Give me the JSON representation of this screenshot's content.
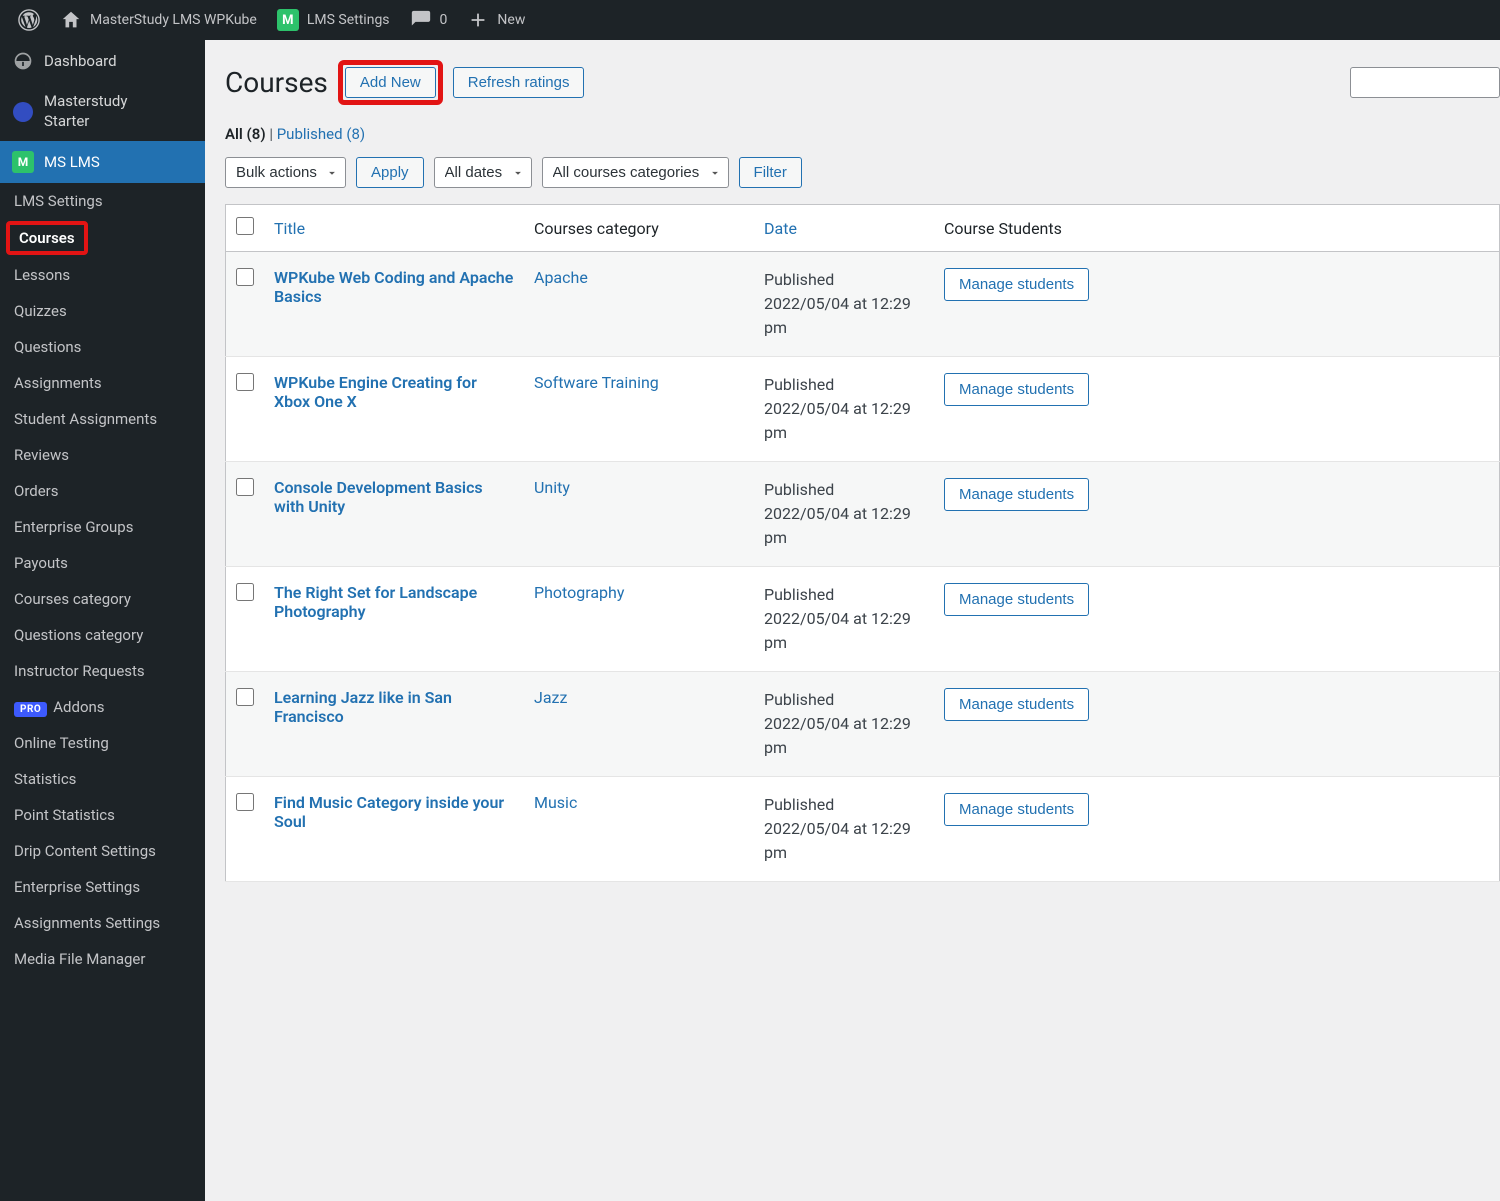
{
  "admin_bar": {
    "site_name": "MasterStudy LMS WPKube",
    "lms_settings": "LMS Settings",
    "comments_count": "0",
    "new": "New"
  },
  "sidebar": {
    "top": [
      {
        "name": "dashboard",
        "label": "Dashboard"
      },
      {
        "name": "masterstudy-starter",
        "label": "Masterstudy\nStarter"
      },
      {
        "name": "ms-lms",
        "label": "MS LMS"
      }
    ],
    "submenu": [
      "LMS Settings",
      "Courses",
      "Lessons",
      "Quizzes",
      "Questions",
      "Assignments",
      "Student Assignments",
      "Reviews",
      "Orders",
      "Enterprise Groups",
      "Payouts",
      "Courses category",
      "Questions category",
      "Instructor Requests",
      "Addons",
      "Online Testing",
      "Statistics",
      "Point Statistics",
      "Drip Content Settings",
      "Enterprise Settings",
      "Assignments Settings",
      "Media File Manager"
    ],
    "pro_label": "PRO"
  },
  "page": {
    "title": "Courses",
    "add_new": "Add New",
    "refresh_ratings": "Refresh ratings"
  },
  "status_filter": {
    "all_label": "All",
    "all_count": "(8)",
    "sep": " | ",
    "published_label": "Published",
    "published_count": "(8)"
  },
  "filters": {
    "bulk": "Bulk actions",
    "apply": "Apply",
    "dates": "All dates",
    "categories": "All courses categories",
    "filter": "Filter"
  },
  "table": {
    "headers": {
      "title": "Title",
      "category": "Courses category",
      "date": "Date",
      "students": "Course Students"
    },
    "manage_label": "Manage students",
    "rows": [
      {
        "title": "WPKube Web Coding and Apache Basics",
        "category": "Apache",
        "status": "Published",
        "date": "2022/05/04 at 12:29 pm"
      },
      {
        "title": "WPKube Engine Creating for Xbox One X",
        "category": "Software Training",
        "status": "Published",
        "date": "2022/05/04 at 12:29 pm"
      },
      {
        "title": "Console Development Basics with Unity",
        "category": "Unity",
        "status": "Published",
        "date": "2022/05/04 at 12:29 pm"
      },
      {
        "title": "The Right Set for Landscape Photography",
        "category": "Photography",
        "status": "Published",
        "date": "2022/05/04 at 12:29 pm"
      },
      {
        "title": "Learning Jazz like in San Francisco",
        "category": "Jazz",
        "status": "Published",
        "date": "2022/05/04 at 12:29 pm"
      },
      {
        "title": "Find Music Category inside your Soul",
        "category": "Music",
        "status": "Published",
        "date": "2022/05/04 at 12:29 pm"
      }
    ]
  }
}
